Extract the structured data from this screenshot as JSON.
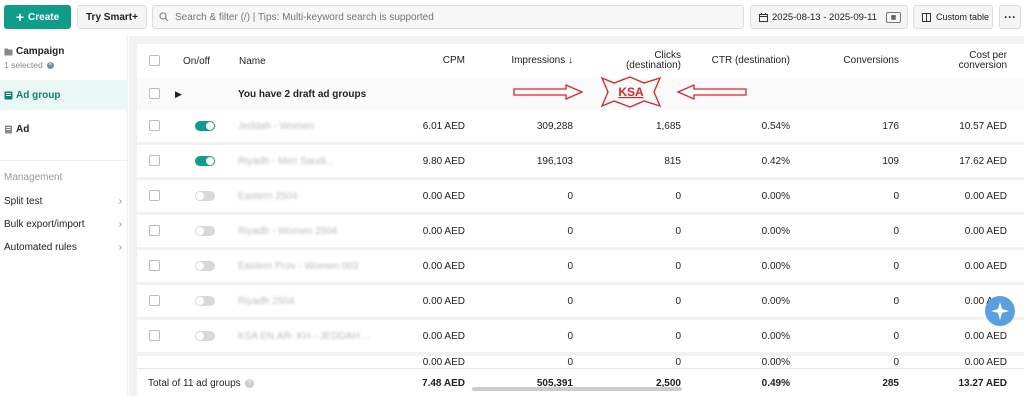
{
  "toolbar": {
    "create_label": "Create",
    "smart_label": "Try Smart+",
    "search_placeholder": "Search & filter (/) | Tips: Multi-keyword search is supported",
    "date_range": "2025-08-13 - 2025-09-11",
    "custom_table_label": "Custom table",
    "more_label": "···"
  },
  "sidebar": {
    "campaign": "Campaign",
    "campaign_selected": "1 selected",
    "adgroup": "Ad group",
    "ad": "Ad",
    "management_heading": "Management",
    "links": [
      "Split test",
      "Bulk export/import",
      "Automated rules"
    ]
  },
  "table": {
    "headers": {
      "onoff": "On/off",
      "name": "Name",
      "cpm": "CPM",
      "impressions": "Impressions ↓",
      "clicks": "Clicks (destination)",
      "ctr": "CTR (destination)",
      "conversions": "Conversions",
      "cost_per_conversion": "Cost per conversion"
    },
    "draft_text": "You have 2 draft ad groups",
    "annotation": "KSA",
    "rows": [
      {
        "on": true,
        "name": "Jeddah - Women",
        "cpm": "6.01 AED",
        "impressions": "309,288",
        "clicks": "1,685",
        "ctr": "0.54%",
        "conversions": "176",
        "cpc": "10.57 AED"
      },
      {
        "on": true,
        "name": "Riyadh - Men Saudi...",
        "cpm": "9.80 AED",
        "impressions": "196,103",
        "clicks": "815",
        "ctr": "0.42%",
        "conversions": "109",
        "cpc": "17.62 AED"
      },
      {
        "on": false,
        "name": "Eastern 2504",
        "cpm": "0.00 AED",
        "impressions": "0",
        "clicks": "0",
        "ctr": "0.00%",
        "conversions": "0",
        "cpc": "0.00 AED"
      },
      {
        "on": false,
        "name": "Riyadh - Women 2504",
        "cpm": "0.00 AED",
        "impressions": "0",
        "clicks": "0",
        "ctr": "0.00%",
        "conversions": "0",
        "cpc": "0.00 AED"
      },
      {
        "on": false,
        "name": "Eastern Prov - Women 003",
        "cpm": "0.00 AED",
        "impressions": "0",
        "clicks": "0",
        "ctr": "0.00%",
        "conversions": "0",
        "cpc": "0.00 AED"
      },
      {
        "on": false,
        "name": "Riyadh 2504",
        "cpm": "0.00 AED",
        "impressions": "0",
        "clicks": "0",
        "ctr": "0.00%",
        "conversions": "0",
        "cpc": "0.00 AED"
      },
      {
        "on": false,
        "name": "KSA EN.AR- KH - JEDDAH ...",
        "cpm": "0.00 AED",
        "impressions": "0",
        "clicks": "0",
        "ctr": "0.00%",
        "conversions": "0",
        "cpc": "0.00 AED"
      }
    ],
    "partial_row": {
      "cpm": "0.00 AED",
      "impressions": "0",
      "clicks": "0",
      "ctr": "0.00%",
      "conversions": "0",
      "cpc": "0.00 AED"
    },
    "footer": {
      "total_label": "Total of 11 ad groups",
      "cpm": "7.48 AED",
      "impressions": "505,391",
      "clicks": "2,500",
      "ctr": "0.49%",
      "conversions": "285",
      "cpc": "13.27 AED"
    }
  },
  "colors": {
    "accent": "#0f9d8a",
    "annotation": "#d9262b"
  }
}
